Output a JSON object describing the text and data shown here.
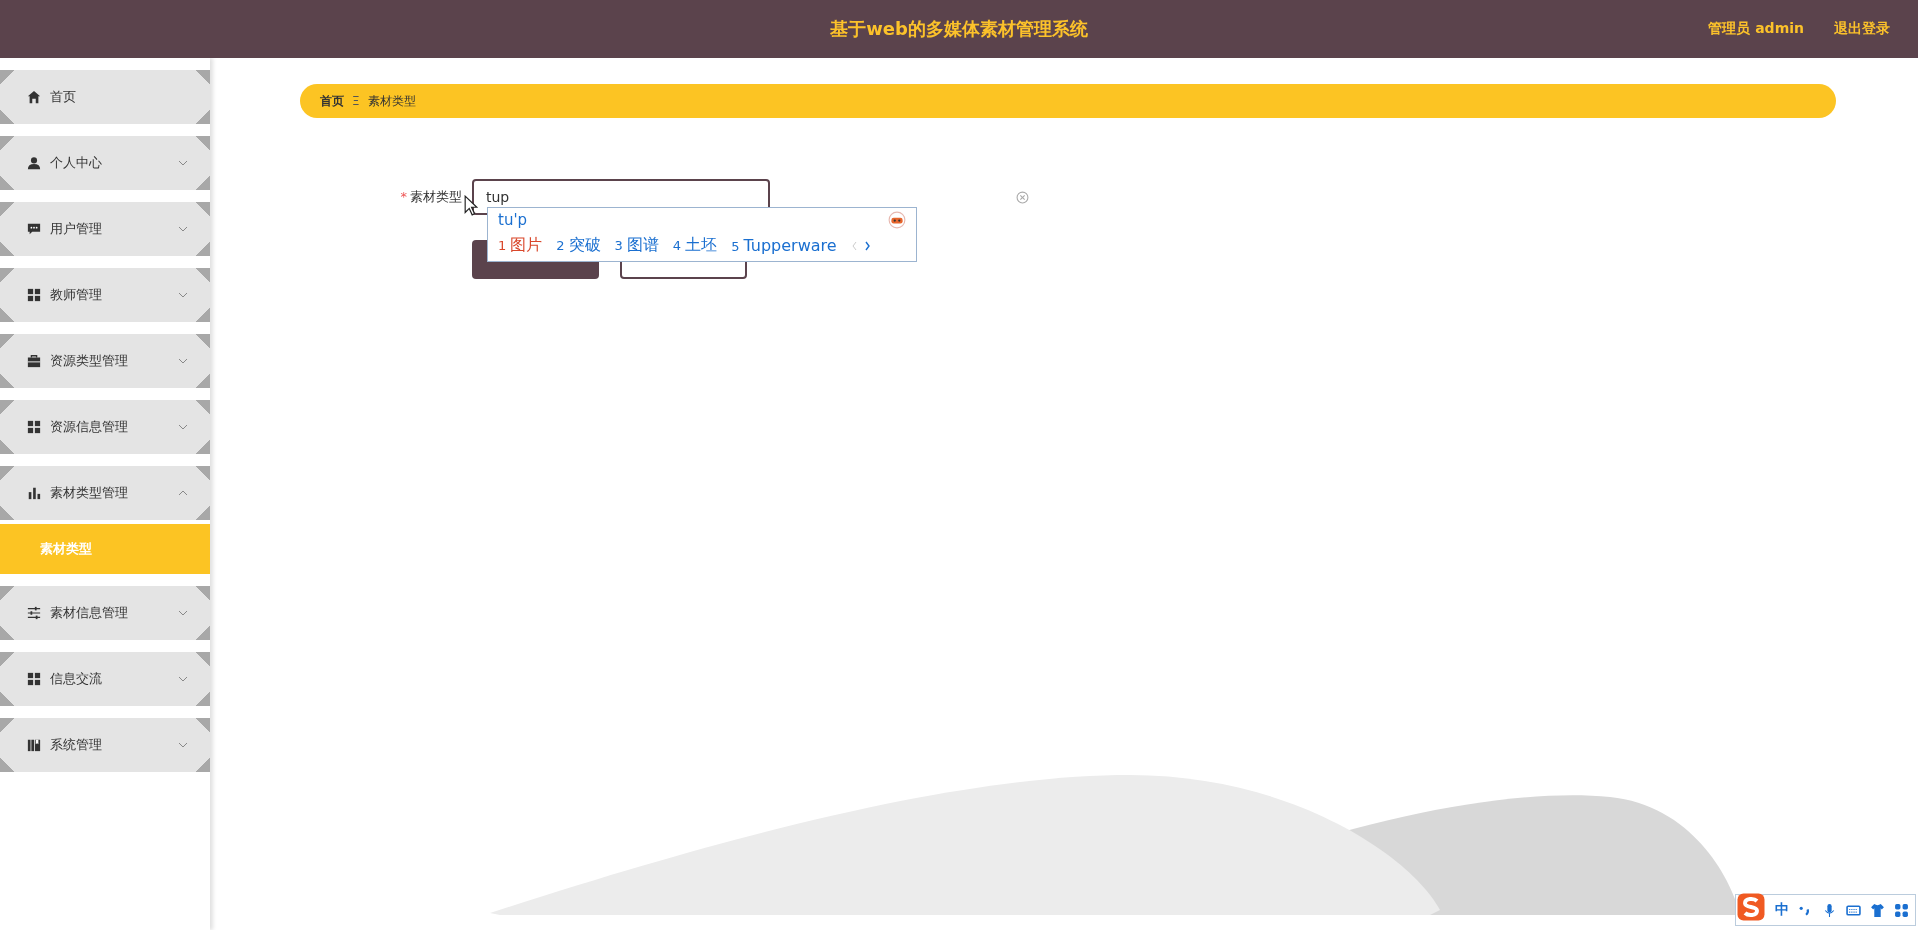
{
  "header": {
    "title": "基于web的多媒体素材管理系统",
    "user": "管理员 admin",
    "logout": "退出登录"
  },
  "sidebar": {
    "items": [
      {
        "kind": "link",
        "label": "首页"
      },
      {
        "kind": "menu",
        "label": "个人中心",
        "expanded": false
      },
      {
        "kind": "menu",
        "label": "用户管理",
        "expanded": false
      },
      {
        "kind": "menu",
        "label": "教师管理",
        "expanded": false
      },
      {
        "kind": "menu",
        "label": "资源类型管理",
        "expanded": false
      },
      {
        "kind": "menu",
        "label": "资源信息管理",
        "expanded": false
      },
      {
        "kind": "menu",
        "label": "素材类型管理",
        "expanded": true,
        "children": [
          {
            "label": "素材类型",
            "selected": true
          }
        ]
      },
      {
        "kind": "menu",
        "label": "素材信息管理",
        "expanded": false
      },
      {
        "kind": "menu",
        "label": "信息交流",
        "expanded": false
      },
      {
        "kind": "menu",
        "label": "系统管理",
        "expanded": false
      }
    ]
  },
  "breadcrumb": {
    "items": [
      "首页",
      "素材类型"
    ],
    "separator": "Ξ"
  },
  "form": {
    "field": {
      "required_mark": "*",
      "label": "素材类型",
      "value": "tup"
    }
  },
  "ime_popup": {
    "composition": "tu'p",
    "candidates": [
      {
        "number": "1",
        "text": "图片",
        "selected": true
      },
      {
        "number": "2",
        "text": "突破",
        "selected": false
      },
      {
        "number": "3",
        "text": "图谱",
        "selected": false
      },
      {
        "number": "4",
        "text": "土坯",
        "selected": false
      },
      {
        "number": "5",
        "text": "Tupperware",
        "selected": false
      }
    ]
  },
  "ime_toolbar": {
    "mode": "中"
  }
}
